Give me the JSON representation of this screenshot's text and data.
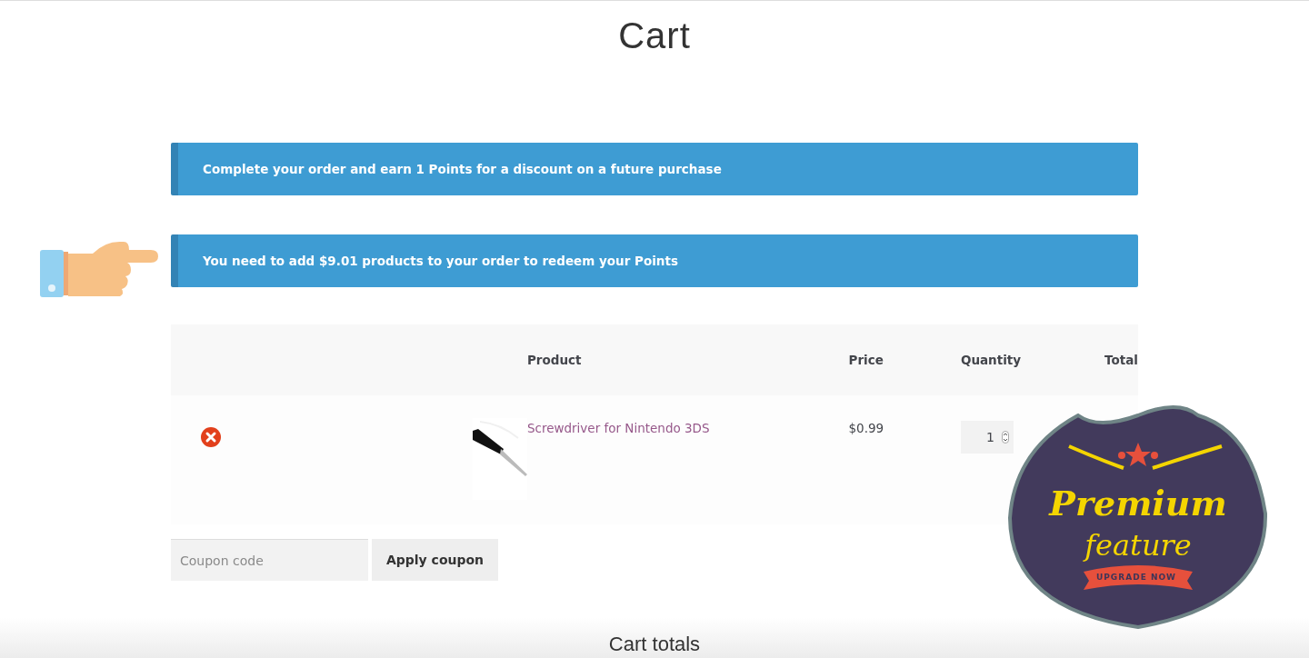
{
  "title": "Cart",
  "notices": [
    {
      "text": "Complete your order and earn **1 Points** for a discount on a future purchase",
      "pointer": false
    },
    {
      "text": "You need to add $9.01 products to your order to redeem your Points",
      "pointer": true
    }
  ],
  "table": {
    "columns": [
      "Product",
      "Price",
      "Quantity",
      "Total"
    ],
    "rows": [
      {
        "product": "Screwdriver for Nintendo 3DS",
        "price": "$0.99",
        "quantity": "1"
      }
    ]
  },
  "coupon": {
    "placeholder": "Coupon code",
    "button": "Apply coupon"
  },
  "badge": {
    "title": "Premium",
    "subtitle": "feature",
    "ribbon": "UPGRADE NOW"
  },
  "cart_totals": {
    "title": "Cart totals"
  }
}
